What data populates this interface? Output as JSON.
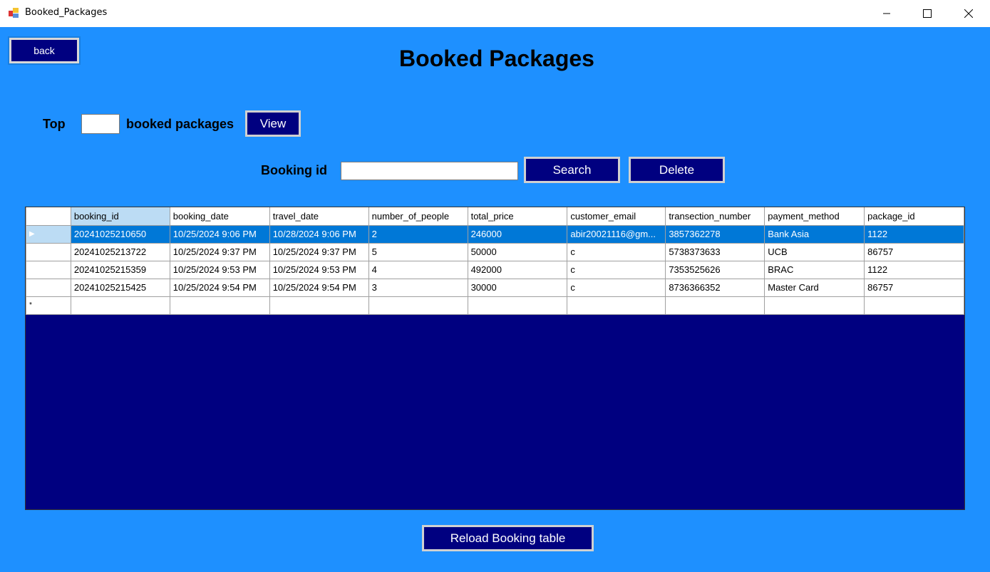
{
  "window": {
    "title": "Booked_Packages"
  },
  "header": {
    "title": "Booked Packages",
    "back_label": "back"
  },
  "top_filter": {
    "prefix": "Top",
    "value": "",
    "suffix": "booked packages",
    "view_label": "View"
  },
  "search": {
    "label": "Booking id",
    "value": "",
    "search_label": "Search",
    "delete_label": "Delete"
  },
  "table": {
    "columns": [
      "booking_id",
      "booking_date",
      "travel_date",
      "number_of_people",
      "total_price",
      "customer_email",
      "transection_number",
      "payment_method",
      "package_id"
    ],
    "rows": [
      [
        "20241025210650",
        "10/25/2024 9:06 PM",
        "10/28/2024 9:06 PM",
        "2",
        "246000",
        "abir20021116@gm...",
        "3857362278",
        "Bank Asia",
        "1122"
      ],
      [
        "20241025213722",
        "10/25/2024 9:37 PM",
        "10/25/2024 9:37 PM",
        "5",
        "50000",
        "c",
        "5738373633",
        "UCB",
        "86757"
      ],
      [
        "20241025215359",
        "10/25/2024 9:53 PM",
        "10/25/2024 9:53 PM",
        "4",
        "492000",
        "c",
        "7353525626",
        "BRAC",
        "1122"
      ],
      [
        "20241025215425",
        "10/25/2024 9:54 PM",
        "10/25/2024 9:54 PM",
        "3",
        "30000",
        "c",
        "8736366352",
        "Master Card",
        "86757"
      ]
    ],
    "selected_row": 0,
    "current_row_marker": "▶",
    "new_row_marker": "*"
  },
  "footer": {
    "reload_label": "Reload Booking table"
  },
  "colors": {
    "background": "#1e90ff",
    "button": "#000080",
    "grid_background": "#000080",
    "selection": "#0078d7"
  }
}
